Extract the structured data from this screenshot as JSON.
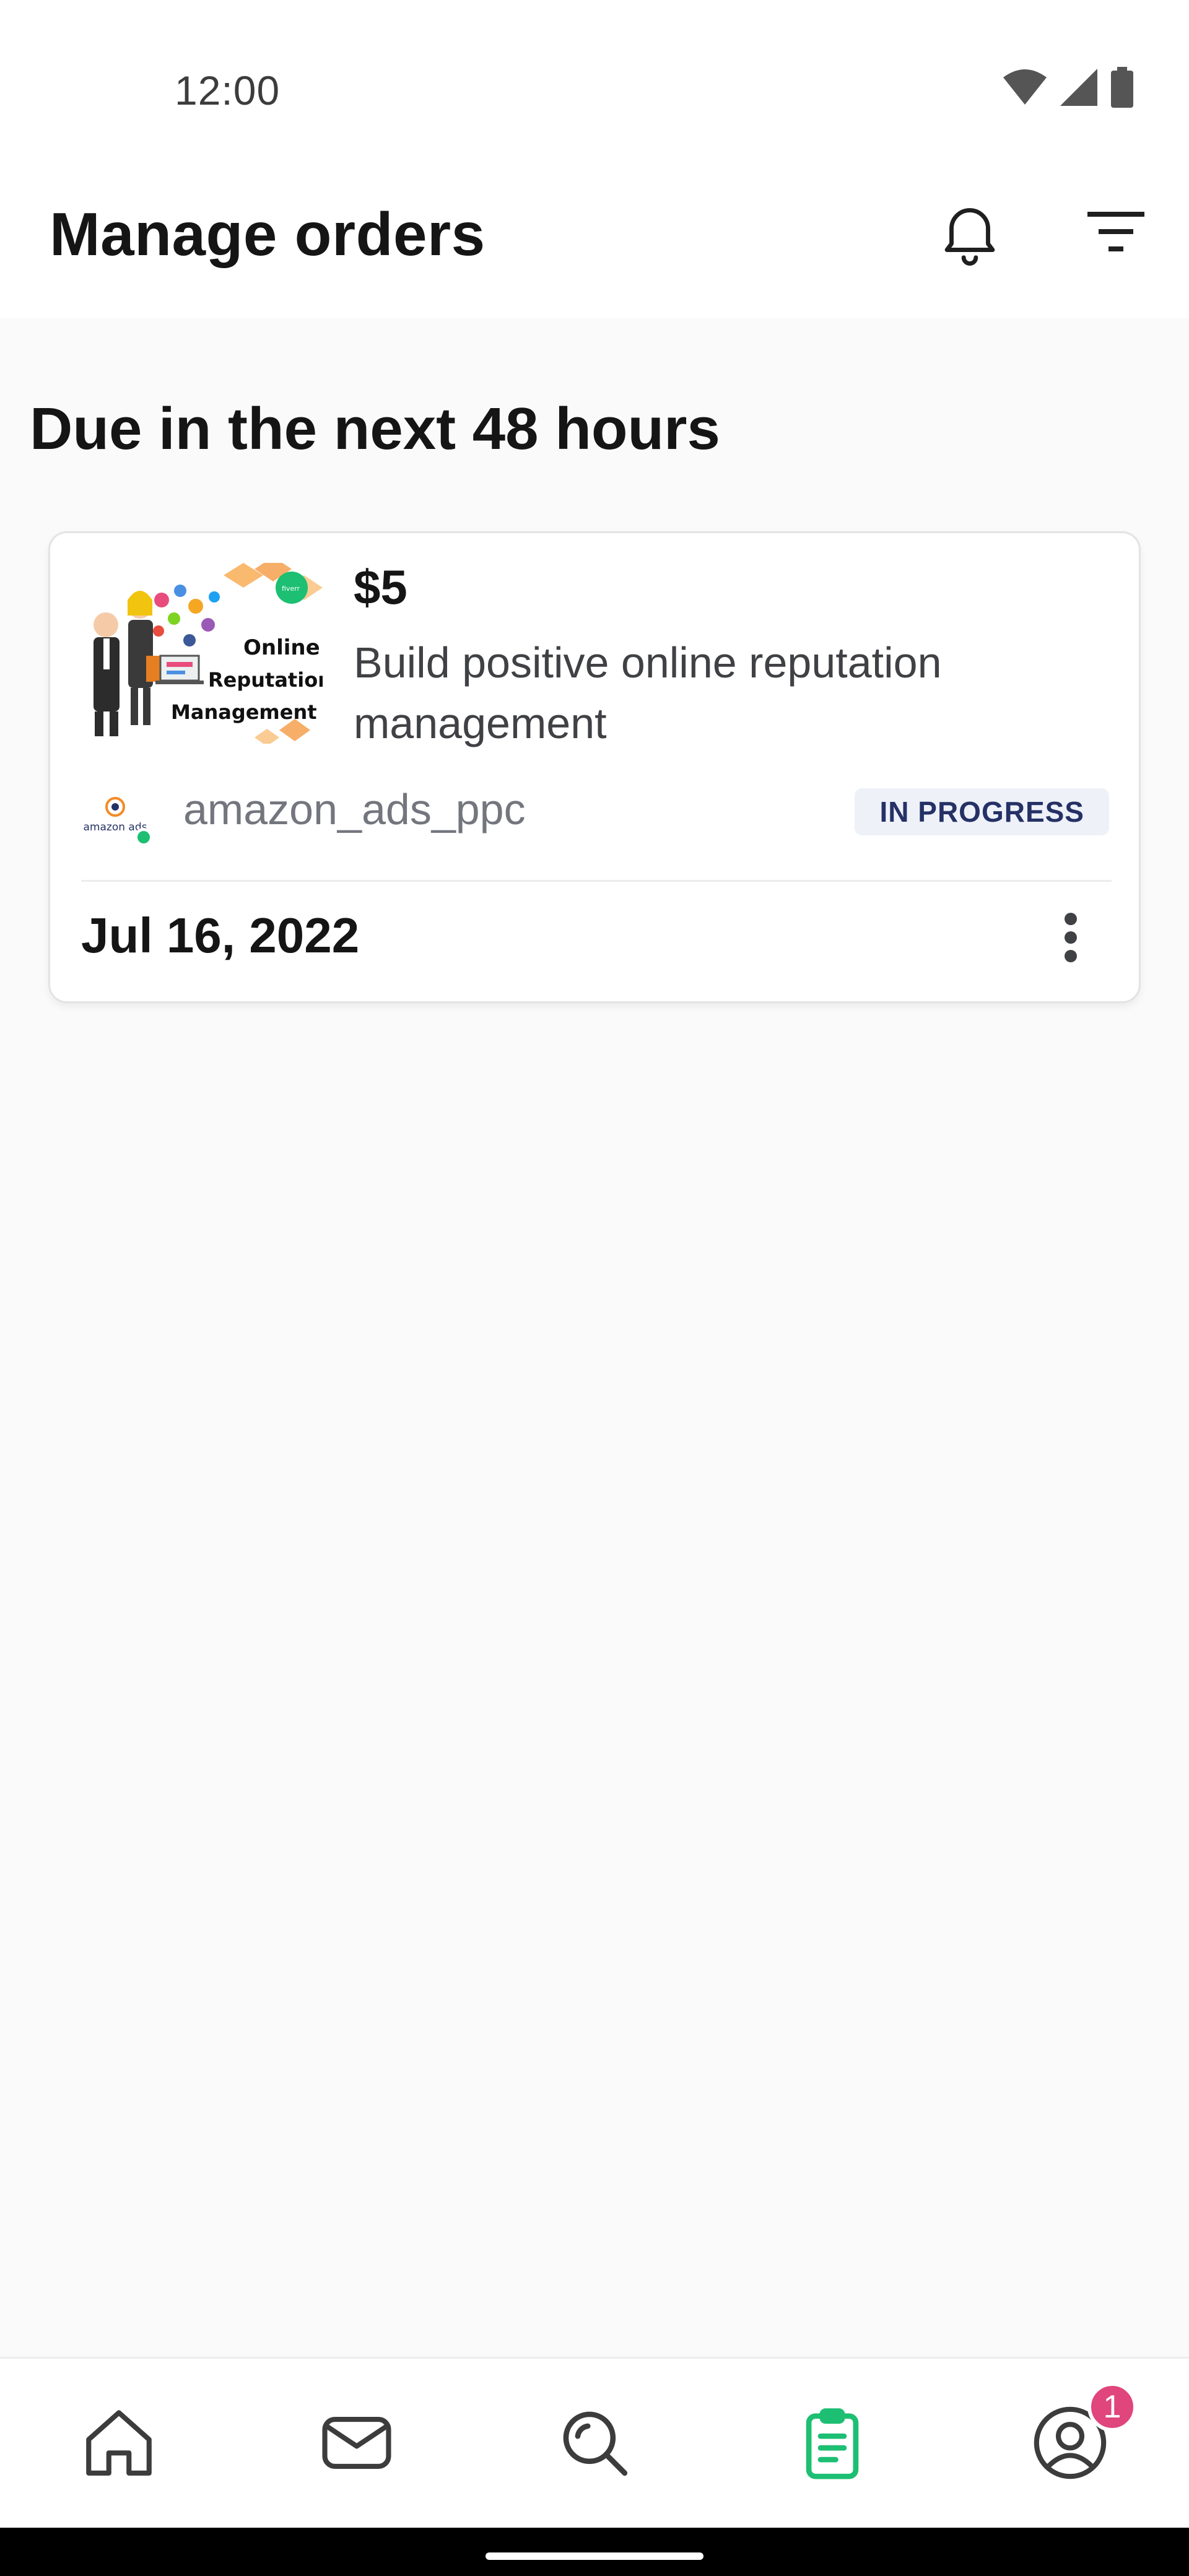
{
  "status_bar": {
    "time": "12:00",
    "icons": [
      "wifi-icon",
      "cellular-signal-icon",
      "battery-icon"
    ]
  },
  "app_bar": {
    "title": "Manage orders",
    "actions": [
      "bell-icon",
      "filter-icon"
    ]
  },
  "section": {
    "title": "Due in the next 48 hours"
  },
  "order": {
    "price": "$5",
    "gig_title": "Build positive online reputation management",
    "thumbnail": {
      "lines": [
        "Online",
        "Reputation",
        "Management"
      ],
      "badge": "fiverr"
    },
    "seller": {
      "avatar_text": "amazon ads",
      "name": "amazon_ads_ppc",
      "online": true
    },
    "status": "IN PROGRESS",
    "due_date": "Jul 16, 2022"
  },
  "bottom_nav": {
    "items": [
      "home-icon",
      "inbox-icon",
      "search-icon",
      "orders-icon",
      "profile-icon"
    ],
    "active": "orders-icon",
    "profile_badge": "1"
  },
  "colors": {
    "accent_green": "#1dbf73",
    "badge_pink": "#e0457b",
    "status_badge_bg": "#eef1f8",
    "status_badge_text": "#253166"
  }
}
